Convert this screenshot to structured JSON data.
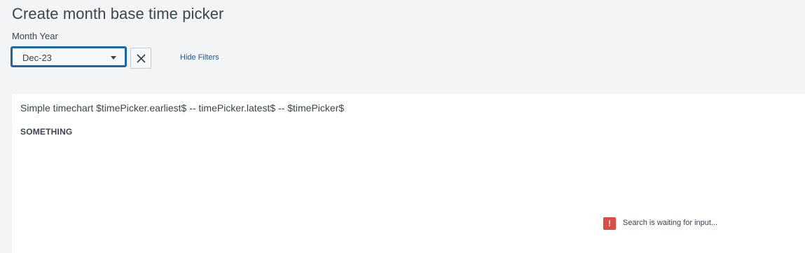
{
  "page": {
    "title": "Create month base time picker"
  },
  "filters": {
    "month_year_label": "Month Year",
    "month_year_value": "Dec-23",
    "hide_filters_label": "Hide Filters"
  },
  "panel": {
    "title": "Simple timechart $timePicker.earliest$ -- timePicker.latest$ -- $timePicker$",
    "subtitle": "SOMETHING",
    "status_text": "Search is waiting for input...",
    "status_icon": "!"
  },
  "colors": {
    "accent": "#1a67a8",
    "link": "#1e5b96",
    "alert": "#dc4e41",
    "background": "#f2f4f5"
  },
  "icons": {
    "dropdown": "caret-down-icon",
    "clear": "close-icon",
    "status": "alert-icon"
  }
}
